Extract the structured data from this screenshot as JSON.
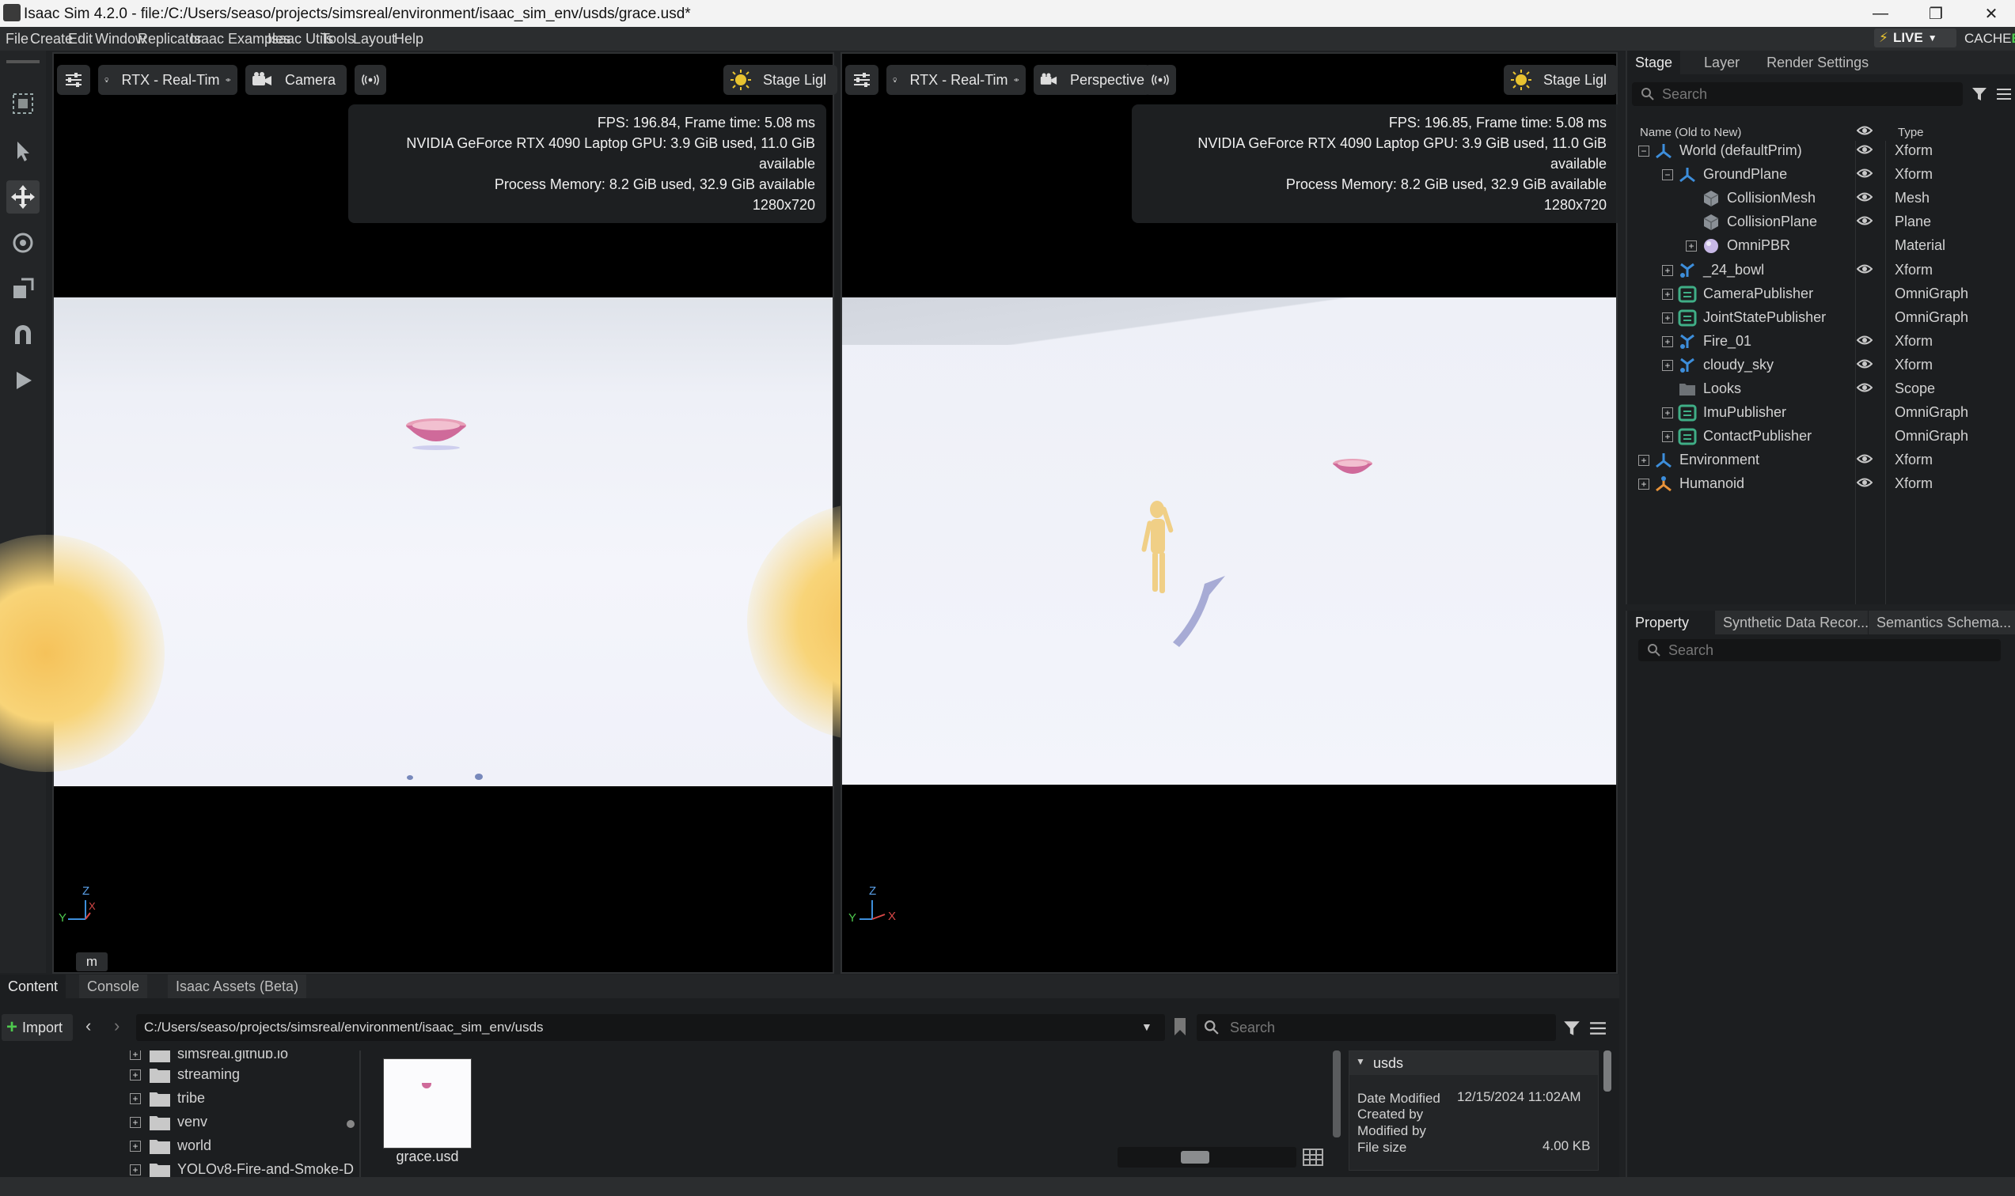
{
  "window": {
    "title": "Isaac Sim 4.2.0 - file:/C:/Users/seaso/projects/simsreal/environment/isaac_sim_env/usds/grace.usd*"
  },
  "menu": [
    "File",
    "Create",
    "Edit",
    "Window",
    "Replicator",
    "Isaac Examples",
    "Isaac Utils",
    "Tools",
    "Layout",
    "Help"
  ],
  "live": {
    "label": "LIVE",
    "cache_label": "CACHE",
    "cache_status": "E"
  },
  "viewport1": {
    "render_mode": "RTX - Real-Tim",
    "camera": "Camera",
    "lights": "Stage Ligl",
    "stats": {
      "fps": "FPS: 196.84, Frame time: 5.08 ms",
      "gpu": "NVIDIA GeForce RTX 4090 Laptop GPU: 3.9 GiB used, 11.0 GiB available",
      "memory": "Process Memory: 8.2 GiB used, 32.9 GiB available",
      "resolution": "1280x720"
    },
    "axis": {
      "z": "Z",
      "y": "Y",
      "x": "X"
    },
    "units": "m"
  },
  "viewport2": {
    "render_mode": "RTX - Real-Tim",
    "camera": "Perspective",
    "lights": "Stage Ligl",
    "stats": {
      "fps": "FPS: 196.85, Frame time: 5.08 ms",
      "gpu": "NVIDIA GeForce RTX 4090 Laptop GPU: 3.9 GiB used, 11.0 GiB available",
      "memory": "Process Memory: 8.2 GiB used, 32.9 GiB available",
      "resolution": "1280x720"
    },
    "axis": {
      "z": "Z",
      "y": "Y",
      "x": "X"
    }
  },
  "stage": {
    "tabs": [
      "Stage",
      "Layer",
      "Render Settings"
    ],
    "search_placeholder": "Search",
    "header": {
      "name": "Name (Old to New)",
      "type": "Type"
    },
    "rows": [
      {
        "name": "World (defaultPrim)",
        "type": "Xform",
        "expander": "−",
        "eye": true
      },
      {
        "name": "GroundPlane",
        "type": "Xform",
        "expander": "−",
        "eye": true
      },
      {
        "name": "CollisionMesh",
        "type": "Mesh",
        "expander": "",
        "eye": true
      },
      {
        "name": "CollisionPlane",
        "type": "Plane",
        "expander": "",
        "eye": true
      },
      {
        "name": "OmniPBR",
        "type": "Material",
        "expander": "+",
        "eye": false
      },
      {
        "name": "_24_bowl",
        "type": "Xform",
        "expander": "+",
        "eye": true
      },
      {
        "name": "CameraPublisher",
        "type": "OmniGraph",
        "expander": "+",
        "eye": false
      },
      {
        "name": "JointStatePublisher",
        "type": "OmniGraph",
        "expander": "+",
        "eye": false
      },
      {
        "name": "Fire_01",
        "type": "Xform",
        "expander": "+",
        "eye": true
      },
      {
        "name": "cloudy_sky",
        "type": "Xform",
        "expander": "+",
        "eye": true
      },
      {
        "name": "Looks",
        "type": "Scope",
        "expander": "",
        "eye": true
      },
      {
        "name": "ImuPublisher",
        "type": "OmniGraph",
        "expander": "+",
        "eye": false
      },
      {
        "name": "ContactPublisher",
        "type": "OmniGraph",
        "expander": "+",
        "eye": false
      },
      {
        "name": "Environment",
        "type": "Xform",
        "expander": "+",
        "eye": true
      },
      {
        "name": "Humanoid",
        "type": "Xform",
        "expander": "+",
        "eye": true
      }
    ]
  },
  "property": {
    "tabs": [
      "Property",
      "Synthetic Data Recor...",
      "Semantics Schema..."
    ],
    "search_placeholder": "Search"
  },
  "content": {
    "tabs": [
      "Content",
      "Console",
      "Isaac Assets (Beta)"
    ],
    "import_label": "Import",
    "path": "C:/Users/seaso/projects/simsreal/environment/isaac_sim_env/usds",
    "search_placeholder": "Search",
    "folders": [
      "simsreal.github.io",
      "streaming",
      "tribe",
      "venv",
      "world",
      "YOLOv8-Fire-and-Smoke-D"
    ],
    "file": {
      "name": "grace.usd"
    },
    "info": {
      "folder": "usds",
      "date_modified_label": "Date Modified",
      "date_modified": "12/15/2024 11:02AM",
      "created_by_label": "Created by",
      "modified_by_label": "Modified by",
      "file_size_label": "File size",
      "file_size": "4.00 KB"
    }
  },
  "colors": {
    "accent_live": "#e8c330",
    "cache_ok": "#4ec94e",
    "xform_icon": "#3d8edb",
    "graph_icon": "#3fae86"
  }
}
